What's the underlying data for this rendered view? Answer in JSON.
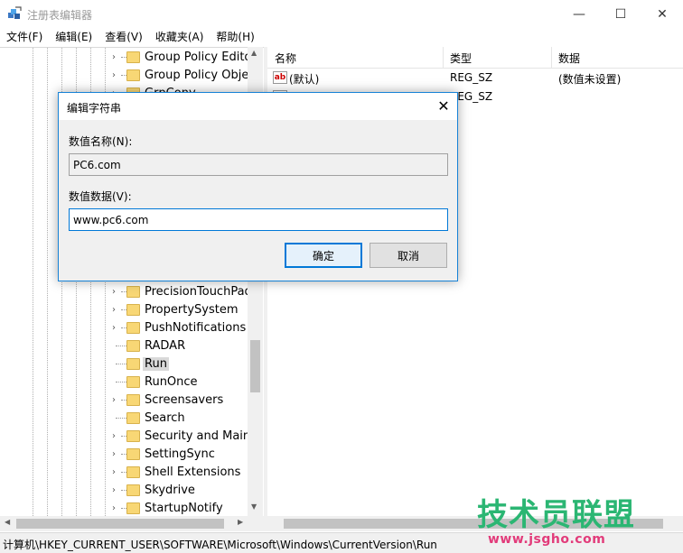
{
  "window": {
    "title": "注册表编辑器",
    "minimize": "—",
    "maximize": "☐",
    "close": "✕"
  },
  "menu": [
    "文件(F)",
    "编辑(E)",
    "查看(V)",
    "收藏夹(A)",
    "帮助(H)"
  ],
  "tree": {
    "items": [
      {
        "label": "Group Policy Editor",
        "expandable": true
      },
      {
        "label": "Group Policy Objec",
        "expandable": true
      },
      {
        "label": "GrpConv",
        "expandable": true
      },
      {
        "label": "PrecisionTouchPad",
        "expandable": true
      },
      {
        "label": "PropertySystem",
        "expandable": true
      },
      {
        "label": "PushNotifications",
        "expandable": true
      },
      {
        "label": "RADAR",
        "expandable": false
      },
      {
        "label": "Run",
        "expandable": false,
        "selected": true
      },
      {
        "label": "RunOnce",
        "expandable": false
      },
      {
        "label": "Screensavers",
        "expandable": true
      },
      {
        "label": "Search",
        "expandable": false
      },
      {
        "label": "Security and Mainte",
        "expandable": true
      },
      {
        "label": "SettingSync",
        "expandable": true
      },
      {
        "label": "Shell Extensions",
        "expandable": true
      },
      {
        "label": "Skydrive",
        "expandable": true
      },
      {
        "label": "StartupNotify",
        "expandable": true
      }
    ]
  },
  "list": {
    "columns": [
      "名称",
      "类型",
      "数据"
    ],
    "rows": [
      {
        "name": "(默认)",
        "type": "REG_SZ",
        "data": "(数值未设置)",
        "icon": "ab-string-icon",
        "icon_text": "ab"
      },
      {
        "name": "",
        "type": "REG_SZ",
        "data": "",
        "icon": "ab-string-icon",
        "icon_text": "ab"
      }
    ]
  },
  "status": {
    "path": "计算机\\HKEY_CURRENT_USER\\SOFTWARE\\Microsoft\\Windows\\CurrentVersion\\Run"
  },
  "dialog": {
    "title": "编辑字符串",
    "close": "✕",
    "name_label": "数值名称(N):",
    "name_value": "PC6.com",
    "data_label": "数值数据(V):",
    "data_value": "www.pc6.com",
    "ok_label": "确定",
    "cancel_label": "取消"
  },
  "scroll": {
    "up": "▲",
    "down": "▼",
    "left": "◀",
    "right": "▶"
  },
  "tree_chevron": "›",
  "watermark": {
    "main": "技术员联盟",
    "url": "www.jsgho.com"
  },
  "colors": {
    "accent": "#0078d7",
    "folder": "#f8d775",
    "watermark_green": "#2bb673",
    "watermark_pink": "#e23b7a"
  }
}
